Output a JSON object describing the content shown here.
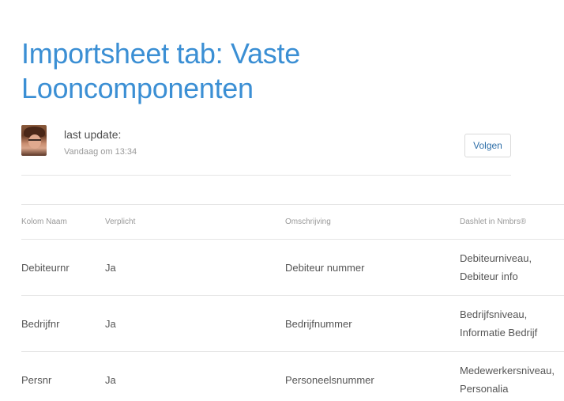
{
  "page": {
    "title": "Importsheet tab: Vaste Looncomponenten"
  },
  "author": {
    "update_label": "last update:",
    "update_time": "Vandaag om 13:34",
    "follow_label": "Volgen"
  },
  "table": {
    "headers": [
      "Kolom Naam",
      "Verplicht",
      "Omschrijving",
      "Dashlet in Nmbrs®"
    ],
    "rows": [
      [
        "Debiteurnr",
        "Ja",
        "Debiteur nummer",
        "Debiteurniveau, Debiteur info"
      ],
      [
        "Bedrijfnr",
        "Ja",
        "Bedrijfnummer",
        "Bedrijfsniveau, Informatie Bedrijf"
      ],
      [
        "Persnr",
        "Ja",
        "Personeelsnummer",
        "Medewerkersniveau, Personalia"
      ]
    ]
  },
  "colors": {
    "title": "#3b8fd4",
    "button_text": "#2f6fa8",
    "divider": "#e5e5e5"
  }
}
